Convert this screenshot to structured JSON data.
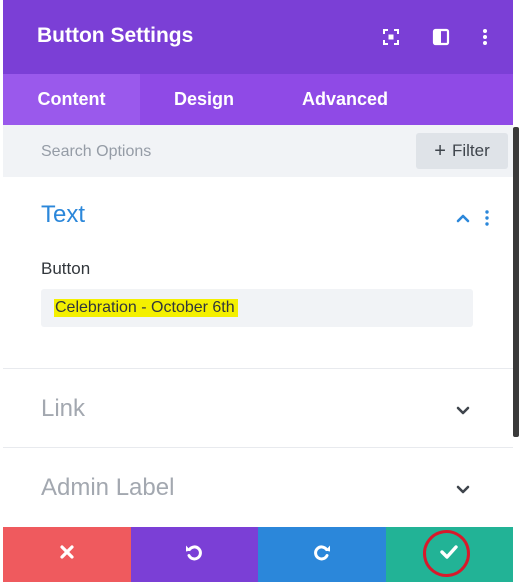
{
  "header": {
    "title": "Button Settings",
    "background": "#7b3fd6",
    "icons": [
      "expand-icon",
      "split-view-icon",
      "more-vertical-icon"
    ]
  },
  "tabs": [
    {
      "label": "Content",
      "active": true
    },
    {
      "label": "Design",
      "active": false
    },
    {
      "label": "Advanced",
      "active": false
    }
  ],
  "search": {
    "placeholder": "Search Options",
    "filter_label": "Filter"
  },
  "sections": {
    "text": {
      "title": "Text",
      "expanded": true,
      "field_label": "Button",
      "field_value": "Celebration - October 6th",
      "highlight_color": "#f4f000"
    },
    "link": {
      "title": "Link",
      "expanded": false
    },
    "admin": {
      "title": "Admin Label",
      "expanded": false
    }
  },
  "footer": {
    "buttons": [
      {
        "name": "cancel",
        "icon": "close-icon",
        "color": "#ef5a5e"
      },
      {
        "name": "undo",
        "icon": "undo-icon",
        "color": "#7b3fd6"
      },
      {
        "name": "redo",
        "icon": "redo-icon",
        "color": "#2b87da"
      },
      {
        "name": "save",
        "icon": "check-icon",
        "color": "#22b396"
      }
    ],
    "annotation_color": "#d8192b"
  },
  "colors": {
    "accent": "#2b87da",
    "tab_bar": "#8f4ae6",
    "active_tab": "#9a59ec"
  }
}
